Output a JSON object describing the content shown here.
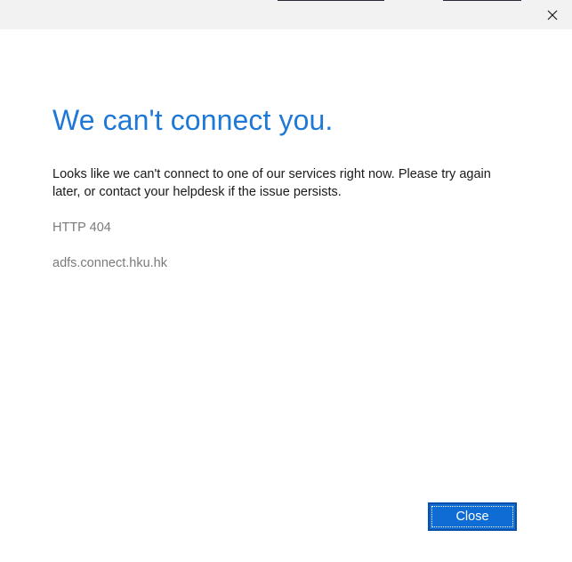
{
  "dialog": {
    "heading": "We can't connect you.",
    "message": "Looks like we can't connect to one of our services right now. Please try again later, or contact your helpdesk if the issue persists.",
    "error_code": "HTTP 404",
    "host": "adfs.connect.hku.hk",
    "close_button_label": "Close"
  },
  "titlebar": {
    "close_icon": "close-icon"
  },
  "colors": {
    "heading": "#1e78d6",
    "button_bg": "#0f6cd4",
    "titlebar_bg": "#f2f2f2",
    "secondary_text": "#7a7a7a"
  }
}
